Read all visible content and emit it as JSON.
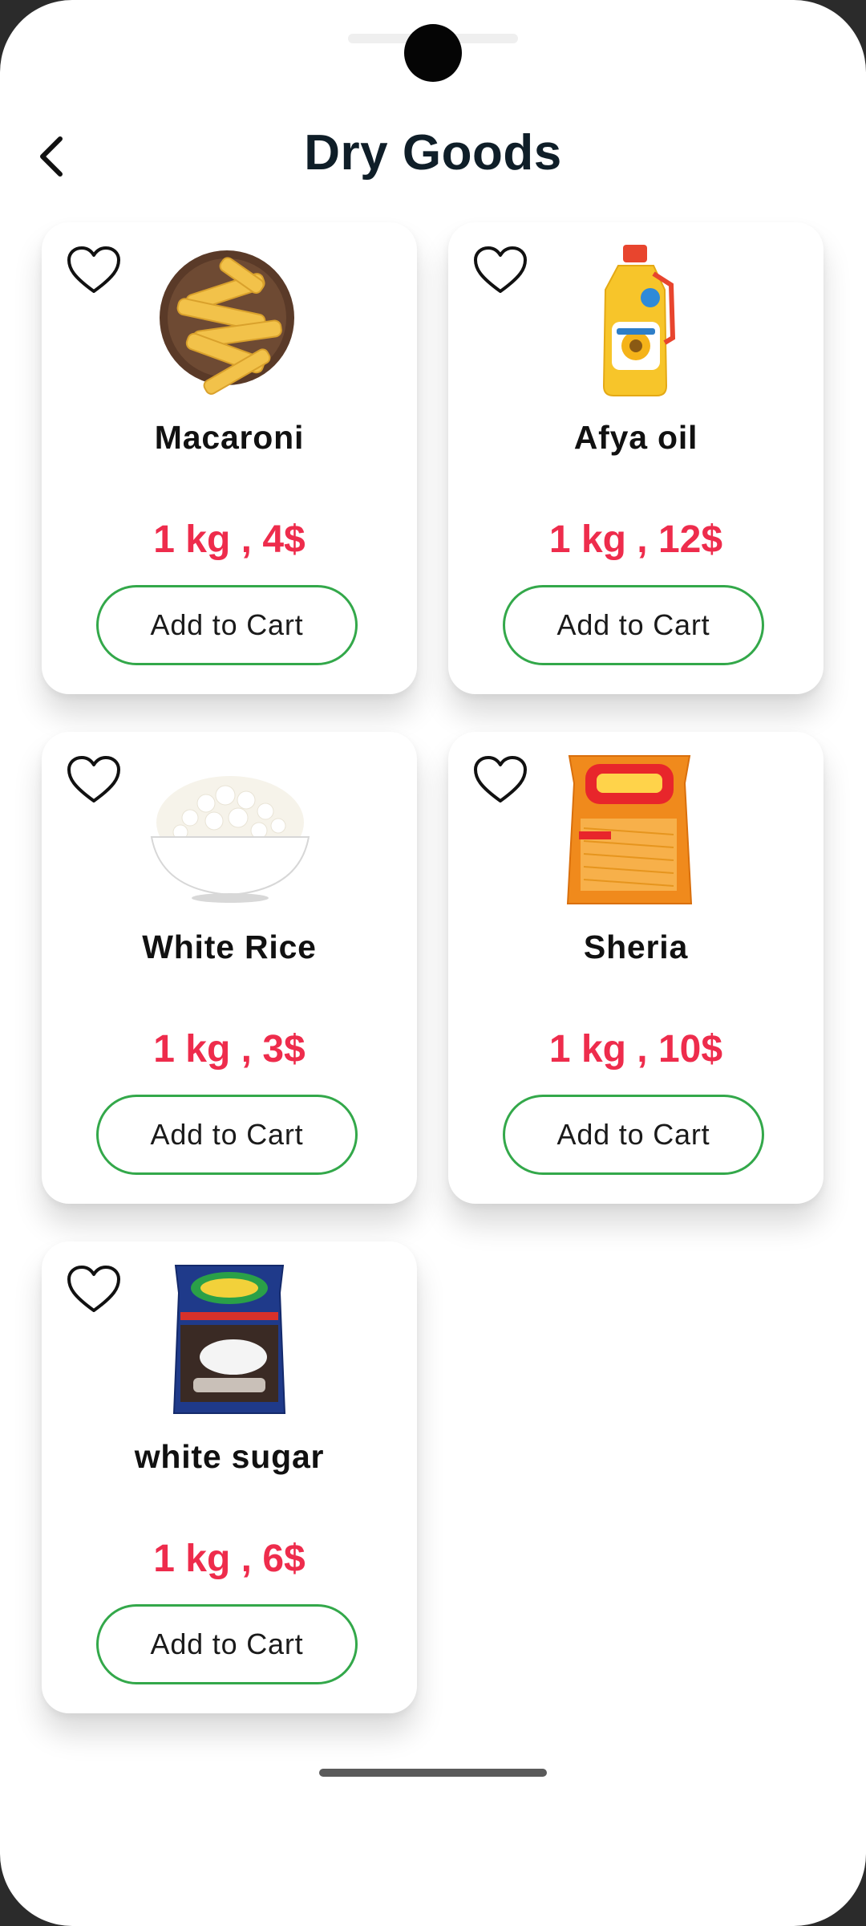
{
  "header": {
    "title": "Dry Goods"
  },
  "products": [
    {
      "name": "Macaroni",
      "price": "1 kg ,  4$",
      "button_label": "Add to Cart",
      "image": "pasta-bowl"
    },
    {
      "name": "Afya oil",
      "price": "1 kg ,  12$",
      "button_label": "Add to Cart",
      "image": "oil-bottle"
    },
    {
      "name": "White Rice",
      "price": "1 kg ,  3$",
      "button_label": "Add to Cart",
      "image": "rice-bowl"
    },
    {
      "name": "Sheria",
      "price": "1 kg ,  10$",
      "button_label": "Add to Cart",
      "image": "vermicelli-bag"
    },
    {
      "name": "white sugar",
      "price": "1 kg ,  6$",
      "button_label": "Add to Cart",
      "image": "sugar-bag"
    }
  ],
  "colors": {
    "price": "#ee2c4c",
    "button_border": "#33a84a",
    "title": "#0f1e28"
  },
  "icons": {
    "back": "chevron-left-icon",
    "favorite": "heart-outline-icon"
  }
}
